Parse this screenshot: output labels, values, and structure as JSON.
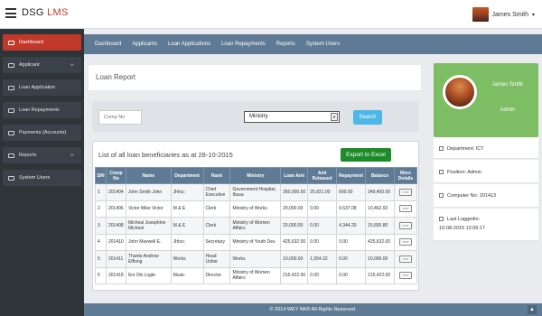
{
  "brand": {
    "part1": "DSG",
    "part2": "LMS"
  },
  "user": {
    "name": "James Smith",
    "caret": "▾"
  },
  "sidebar": {
    "items": [
      {
        "label": "Dashboard",
        "active": true,
        "expandable": false
      },
      {
        "label": "Applicant",
        "active": false,
        "expandable": true
      },
      {
        "label": "Loan Application",
        "active": false,
        "expandable": false
      },
      {
        "label": "Loan Repayments",
        "active": false,
        "expandable": false
      },
      {
        "label": "Payments (Accounts)",
        "active": false,
        "expandable": false
      },
      {
        "label": "Reports",
        "active": false,
        "expandable": true
      },
      {
        "label": "System Users",
        "active": false,
        "expandable": false
      }
    ],
    "plus": "+"
  },
  "subnav": [
    "Dashboard",
    "Applicants",
    "Loan Applications",
    "Loan Repayments",
    "Reports",
    "System Users"
  ],
  "page": {
    "title": "Loan Report"
  },
  "search": {
    "comp_no_placeholder": "Comp No",
    "ministry_selected": "Ministry",
    "ministry_arrow": "▾",
    "button_label": "Search"
  },
  "report": {
    "caption": "List of all loan beneficiaries as at 28-10-2015",
    "export_label": "Export to Excel",
    "columns": [
      "S/N",
      "Comp No",
      "Name",
      "Department",
      "Rank",
      "Ministry",
      "Loan Amt",
      "Amt Released",
      "Repayment",
      "Balance",
      "More Details"
    ],
    "more_label": ">>>",
    "rows": [
      {
        "sn": "1",
        "comp_no": "201404",
        "name": "John Smith John",
        "department": "Jhhcc",
        "rank": "Chief Executive",
        "ministry": "Government Hospital, Ibusa",
        "loan_amt": "350,000.00",
        "amt_released": "25,821.00",
        "repayment": "600.00",
        "balance": "349,400.00"
      },
      {
        "sn": "2",
        "comp_no": "201406",
        "name": "Victor Mike Victor",
        "department": "M & E",
        "rank": "Clerk",
        "ministry": "Ministry of Works",
        "loan_amt": "20,000.00",
        "amt_released": "0.00",
        "repayment": "9,537.08",
        "balance": "10,462.92"
      },
      {
        "sn": "3",
        "comp_no": "201408",
        "name": "Micheal Josephine Micheal",
        "department": "M & E",
        "rank": "Clerk",
        "ministry": "Ministry of Women Affairs",
        "loan_amt": "20,000.00",
        "amt_released": "0.00",
        "repayment": "4,344.20",
        "balance": "15,655.80"
      },
      {
        "sn": "4",
        "comp_no": "201410",
        "name": "John Maxwell E.",
        "department": "Jhhcc",
        "rank": "Secretary",
        "ministry": "Ministry of Youth Dev.",
        "loan_amt": "425,632.00",
        "amt_released": "0.00",
        "repayment": "0.00",
        "balance": "425,632.00"
      },
      {
        "sn": "5",
        "comp_no": "201411",
        "name": "Thante Andrew Effiong",
        "department": "Works",
        "rank": "Head Usher",
        "ministry": "Works",
        "loan_amt": "10,000.00",
        "amt_released": "1,554.32",
        "repayment": "0.00",
        "balance": "10,000.00"
      },
      {
        "sn": "6",
        "comp_no": "201418",
        "name": "Eni Oki Logte",
        "department": "Music",
        "rank": "Director",
        "ministry": "Ministry of Women Affairs",
        "loan_amt": "215,422.00",
        "amt_released": "0.00",
        "repayment": "0.00",
        "balance": "215,422.00"
      }
    ]
  },
  "profile": {
    "name": "James Smith",
    "role": "Admin",
    "department": "Department: ICT",
    "position": "Position: Admin",
    "computer_no": "Computer No: 201413",
    "last_login_label": "Last Loggedin:",
    "last_login_value": "10-08-2015 12:06:17"
  },
  "footer": {
    "text": "© 2014 WEY NK®  All Rights Reserved.",
    "scroll_up": "▲"
  },
  "colors": {
    "accent": "#c0392b",
    "nav": "#5f7a94",
    "sidebar": "#2f3439",
    "excel": "#1e8b2a",
    "search": "#4db7e8",
    "profile": "#7dbd63"
  }
}
